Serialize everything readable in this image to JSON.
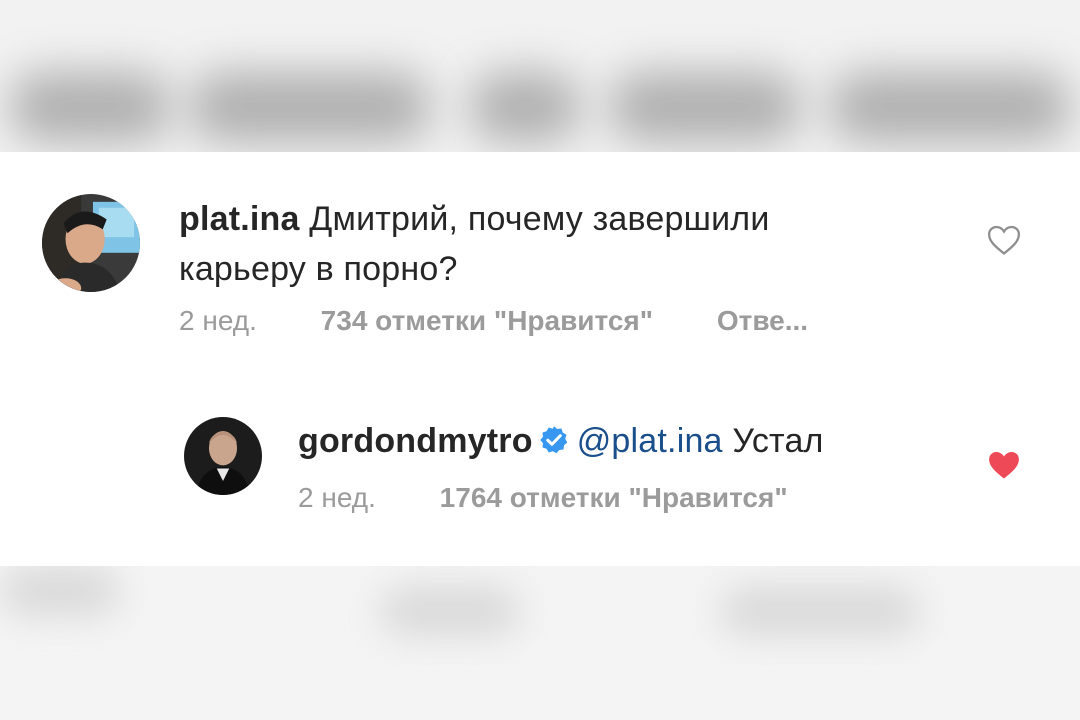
{
  "comments": [
    {
      "username": "plat.ina",
      "text_line1": "Дмитрий, почему завершили",
      "text_line2": "карьеру в порно?",
      "time": "2 нед.",
      "likes": "734 отметки \"Нравится\"",
      "reply": "Отве...",
      "liked": false,
      "avatar_icon": "user-avatar-photo"
    },
    {
      "username": "gordondmytro",
      "verified": true,
      "mention": "@plat.ina",
      "text": "Устал",
      "time": "2 нед.",
      "likes": "1764 отметки \"Нравится\"",
      "liked": true,
      "avatar_icon": "user-avatar-photo"
    }
  ],
  "colors": {
    "heart_liked": "#ed4956",
    "heart_outline": "#8e8e8e",
    "verified_badge": "#3897f0",
    "mention": "#1a4f8b",
    "meta_text": "#9b9b9b",
    "primary_text": "#262626"
  }
}
